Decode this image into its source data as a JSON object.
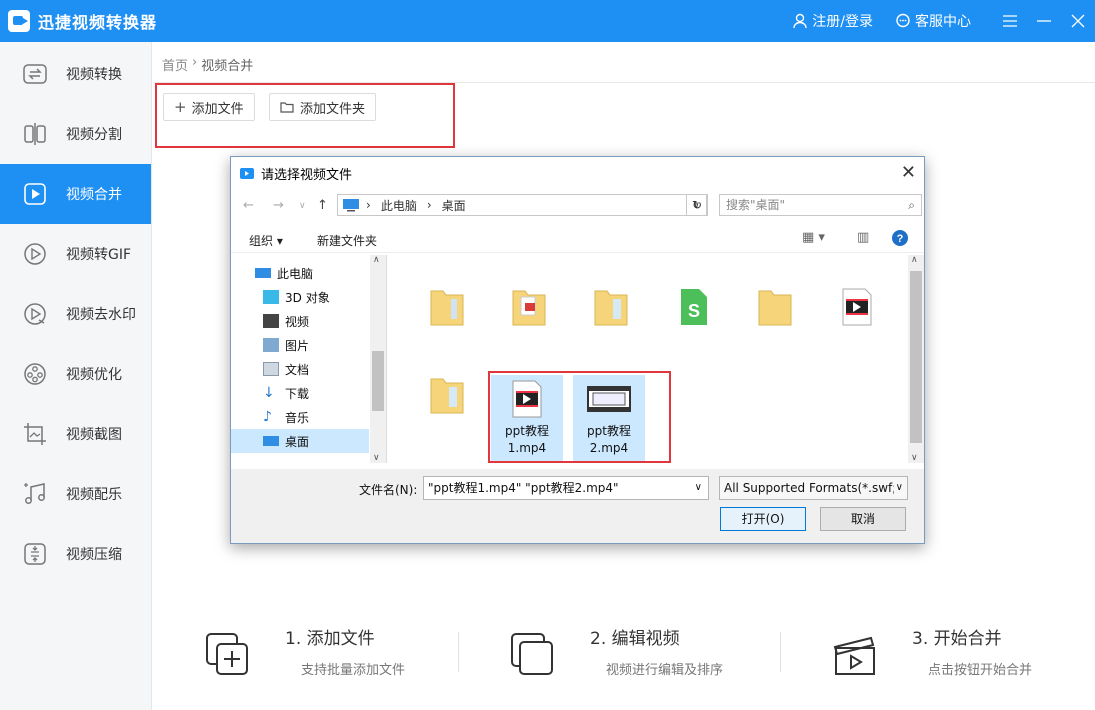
{
  "app": {
    "title": "迅捷视频转换器",
    "login": "注册/登录",
    "service": "客服中心",
    "accent": "#1e8ff3",
    "highlight": "#e0363c"
  },
  "sidebar": {
    "items": [
      {
        "label": "视频转换",
        "icon": "convert-icon"
      },
      {
        "label": "视频分割",
        "icon": "split-icon"
      },
      {
        "label": "视频合并",
        "icon": "merge-icon",
        "active": true
      },
      {
        "label": "视频转GIF",
        "icon": "gif-icon"
      },
      {
        "label": "视频去水印",
        "icon": "watermark-icon"
      },
      {
        "label": "视频优化",
        "icon": "optimize-icon"
      },
      {
        "label": "视频截图",
        "icon": "screenshot-icon"
      },
      {
        "label": "视频配乐",
        "icon": "music-icon"
      },
      {
        "label": "视频压缩",
        "icon": "compress-icon"
      }
    ]
  },
  "breadcrumb": {
    "home": "首页",
    "sep": "›",
    "current": "视频合并"
  },
  "actions": {
    "add_file": "添加文件",
    "add_folder": "添加文件夹"
  },
  "steps": [
    {
      "title": "1. 添加文件",
      "desc": "支持批量添加文件"
    },
    {
      "title": "2. 编辑视频",
      "desc": "视频进行编辑及排序"
    },
    {
      "title": "3. 开始合并",
      "desc": "点击按钮开始合并"
    }
  ],
  "dialog": {
    "title": "请选择视频文件",
    "path": [
      "此电脑",
      "桌面"
    ],
    "search_placeholder": "搜索\"桌面\"",
    "organize": "组织",
    "new_folder": "新建文件夹",
    "nav": [
      {
        "label": "此电脑"
      },
      {
        "label": "3D 对象"
      },
      {
        "label": "视频"
      },
      {
        "label": "图片"
      },
      {
        "label": "文档"
      },
      {
        "label": "下载"
      },
      {
        "label": "音乐"
      },
      {
        "label": "桌面",
        "selected": true
      }
    ],
    "files": [
      {
        "name": "ppt教程\n1.mp4",
        "selected": true
      },
      {
        "name": "ppt教程\n2.mp4",
        "selected": true
      }
    ],
    "filename_label": "文件名(N):",
    "filename_value": "\"ppt教程1.mp4\" \"ppt教程2.mp4\"",
    "format": "All Supported Formats(*.swf;",
    "open": "打开(O)",
    "cancel": "取消"
  }
}
